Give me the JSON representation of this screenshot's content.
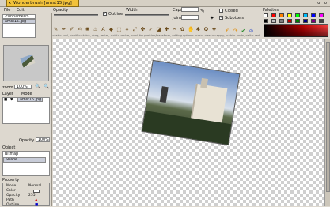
{
  "titlebar": {
    "tab_title": "Wonderbrush [amst15.jpg]",
    "close_glyph": "x",
    "buttons": "o o"
  },
  "menu": {
    "items": [
      "File",
      "Edit"
    ]
  },
  "toolbar": {
    "opacity_label": "Opacity",
    "outline_label": "Outline",
    "width_label": "Width",
    "caps_label": "Caps",
    "joins_label": "Joins",
    "closed_label": "Closed",
    "subpixels_label": "Subpixels",
    "hint": "<tab> tool, <shift><tab>, drag, resize, <ctrl> resize, scroll for position/transform, editing options: <cr>, <esc>=apply, <ctrl>-undo, <alt>-redo"
  },
  "left": {
    "canvas_list": [
      "<unnamed>",
      "amst15.jpg"
    ],
    "zoom_label": "zoom",
    "zoom_value": "100%",
    "layer_label": "Layer",
    "mode_label": "Mode",
    "layer_name": "amst15.jpg",
    "opacity_label": "Opacity",
    "opacity_value": "100%",
    "object_label": "Object",
    "objects": [
      "Bitmap",
      "Shape"
    ],
    "property_label": "Property",
    "properties": [
      {
        "name": "Mode",
        "value": "Normal"
      },
      {
        "name": "Color",
        "value": ""
      },
      {
        "name": "Opacity",
        "value": "255"
      },
      {
        "name": "Path",
        "value": ""
      },
      {
        "name": "Outline",
        "value": ""
      }
    ]
  },
  "right": {
    "palette_label": "Palettes"
  },
  "colors": {
    "accent": "#f2c23a",
    "palette": [
      "#ffffff",
      "#ff0000",
      "#ff8000",
      "#ffff00",
      "#00ff00",
      "#00c0ff",
      "#0000ff",
      "#ff00ff",
      "#000000",
      "#c0c0c0",
      "#808080",
      "#c00000",
      "#008000",
      "#000080",
      "#800080",
      "#404040"
    ]
  }
}
